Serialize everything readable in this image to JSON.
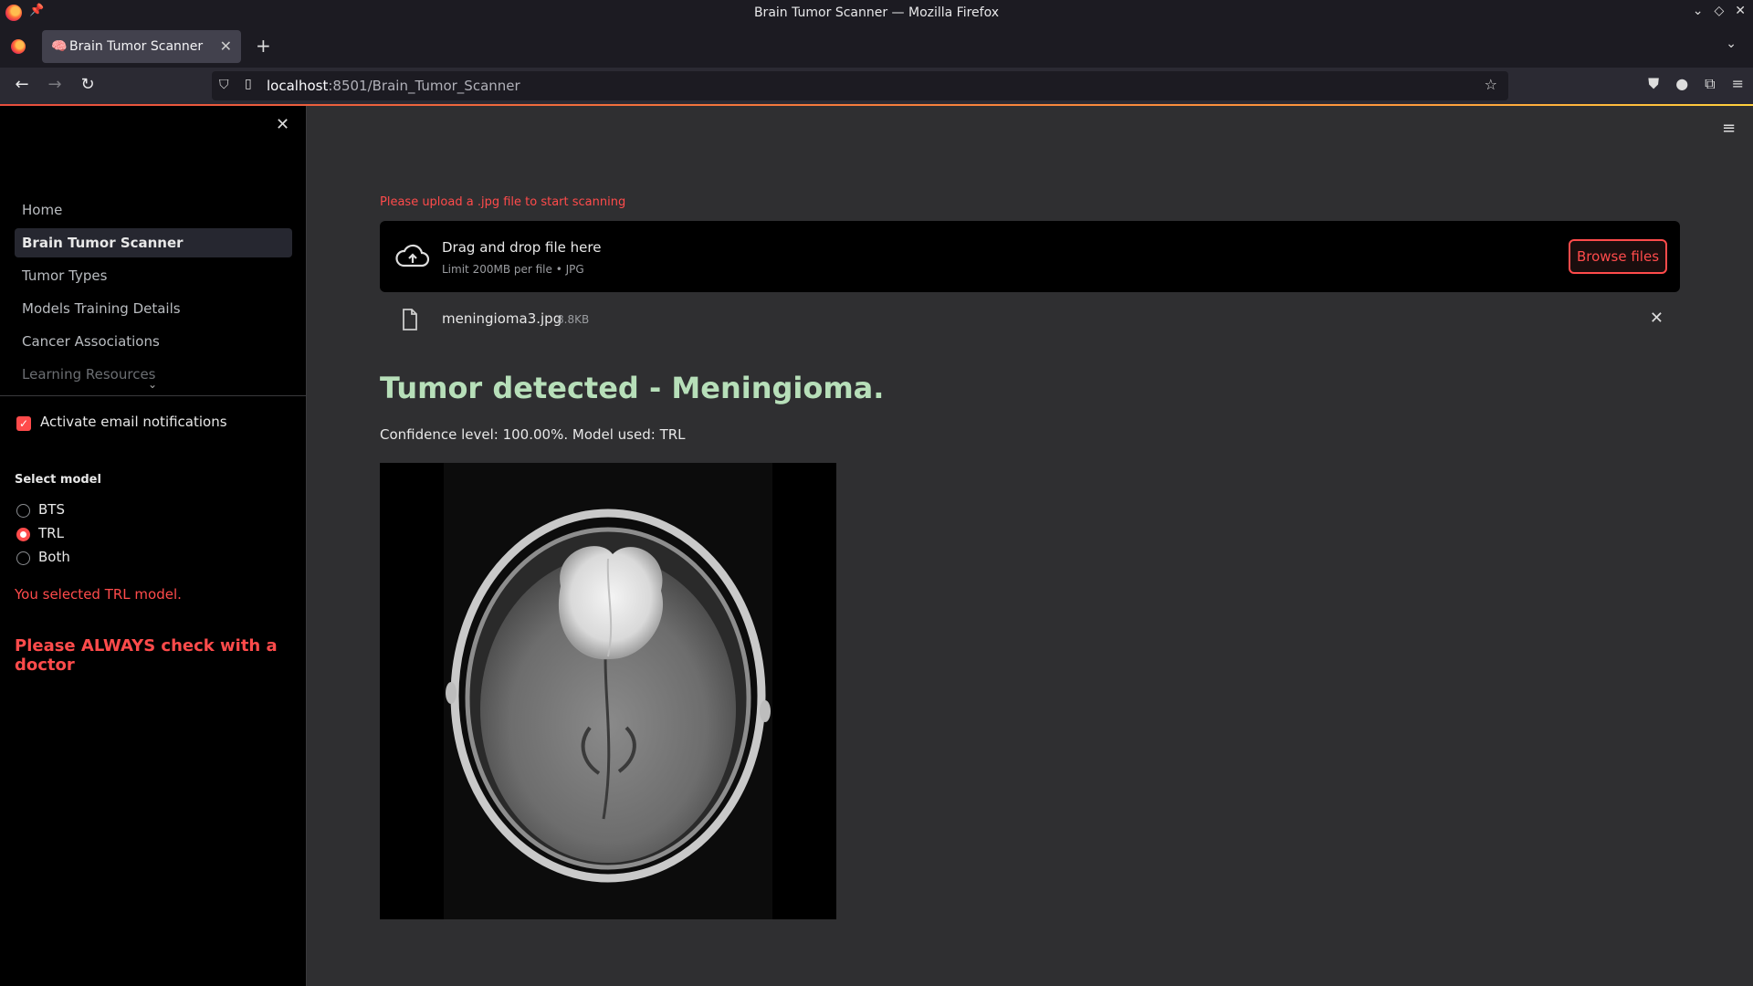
{
  "window": {
    "title": "Brain Tumor Scanner — Mozilla Firefox"
  },
  "browser": {
    "tab_title": "Brain Tumor Scanner",
    "url_host": "localhost",
    "url_rest": ":8501/Brain_Tumor_Scanner"
  },
  "sidebar": {
    "nav": [
      {
        "label": "Home"
      },
      {
        "label": "Brain Tumor Scanner",
        "active": true
      },
      {
        "label": "Tumor Types"
      },
      {
        "label": "Models Training Details"
      },
      {
        "label": "Cancer Associations"
      },
      {
        "label": "Learning Resources"
      }
    ],
    "email_checkbox_label": "Activate email notifications",
    "email_checked": true,
    "model_label": "Select model",
    "models": [
      "BTS",
      "TRL",
      "Both"
    ],
    "selected_model": "TRL",
    "selected_msg": "You selected TRL model.",
    "doctor_msg": "Please ALWAYS check with a doctor"
  },
  "main": {
    "upload_hint": "Please upload a .jpg file to start scanning",
    "dropzone_title": "Drag and drop file here",
    "dropzone_sub": "Limit 200MB per file • JPG",
    "browse_label": "Browse files",
    "file_name": "meningioma3.jpg",
    "file_size": "8.8KB",
    "result_title": "Tumor detected - Meningioma.",
    "confidence": "Confidence level: 100.00%. Model used: TRL"
  },
  "colors": {
    "accent": "#ff4b4b",
    "result_green": "#b7dfb9",
    "sidebar_bg": "#000000",
    "main_bg": "#2f2f31"
  }
}
